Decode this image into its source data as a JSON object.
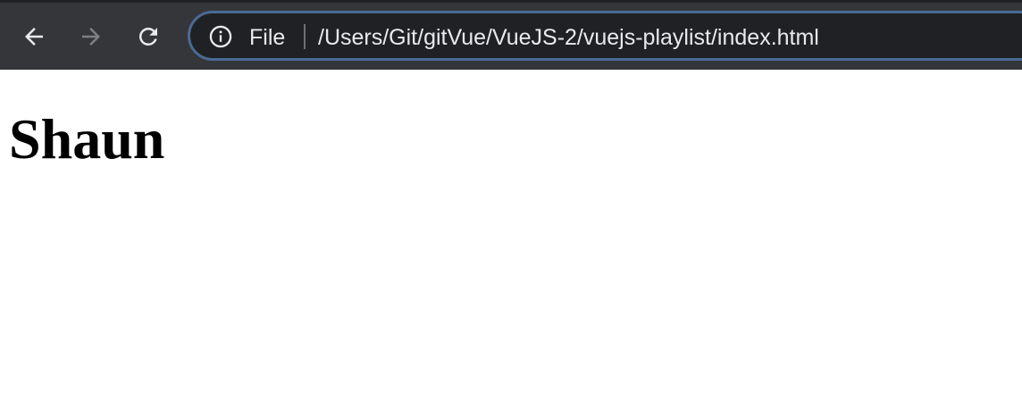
{
  "browser": {
    "nav": {
      "back_icon": "arrow-left-icon",
      "forward_icon": "arrow-right-icon",
      "reload_icon": "reload-icon"
    },
    "omnibox": {
      "info_icon": "info-icon",
      "scheme_label": "File",
      "url": "/Users/Git/gitVue/VueJS-2/vuejs-playlist/index.html"
    },
    "colors": {
      "toolbar": "#35363a",
      "omnibox_background": "#202124",
      "omnibox_border": "#4a6a94",
      "text": "#e8eaed"
    }
  },
  "page": {
    "heading": "Shaun"
  }
}
